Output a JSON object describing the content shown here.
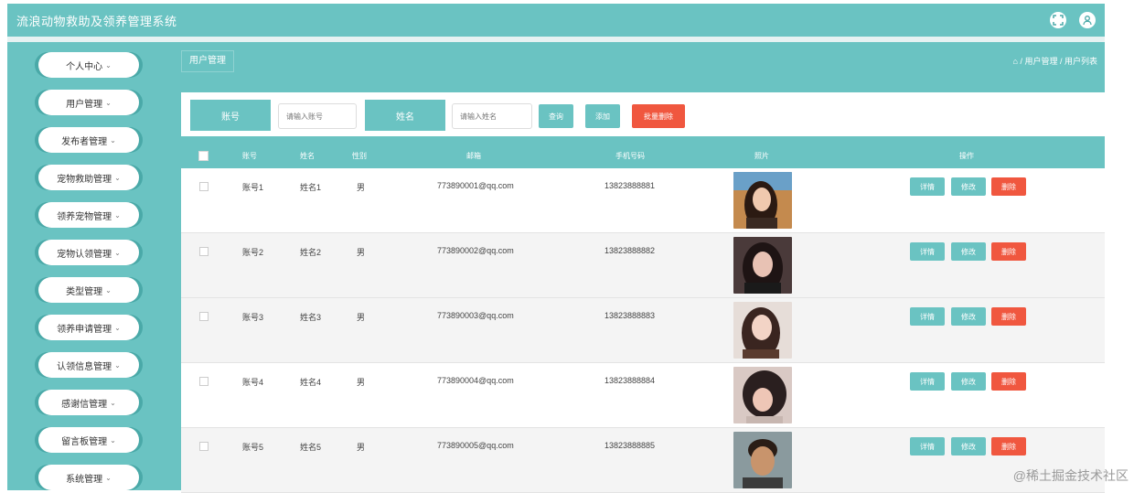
{
  "app": {
    "title": "流浪动物救助及领养管理系统"
  },
  "sidebar": {
    "items": [
      {
        "label": "个人中心"
      },
      {
        "label": "用户管理"
      },
      {
        "label": "发布者管理"
      },
      {
        "label": "宠物救助管理"
      },
      {
        "label": "领养宠物管理"
      },
      {
        "label": "宠物认领管理"
      },
      {
        "label": "类型管理"
      },
      {
        "label": "领养申请管理"
      },
      {
        "label": "认领信息管理"
      },
      {
        "label": "感谢信管理"
      },
      {
        "label": "留言板管理"
      },
      {
        "label": "系统管理"
      }
    ]
  },
  "header": {
    "page_tab": "用户管理",
    "breadcrumb": "⌂ / 用户管理 / 用户列表"
  },
  "search": {
    "account_label": "账号",
    "account_placeholder": "请输入账号",
    "name_label": "姓名",
    "name_placeholder": "请输入姓名",
    "query_btn": "查询",
    "add_btn": "添加",
    "batch_delete_btn": "批量删除"
  },
  "table": {
    "columns": [
      "账号",
      "姓名",
      "性别",
      "邮箱",
      "手机号码",
      "照片",
      "操作"
    ],
    "action_labels": {
      "view": "详情",
      "edit": "修改",
      "delete": "删除"
    },
    "rows": [
      {
        "account": "账号1",
        "name": "姓名1",
        "gender": "男",
        "email": "773890001@qq.com",
        "phone": "13823888881"
      },
      {
        "account": "账号2",
        "name": "姓名2",
        "gender": "男",
        "email": "773890002@qq.com",
        "phone": "13823888882"
      },
      {
        "account": "账号3",
        "name": "姓名3",
        "gender": "男",
        "email": "773890003@qq.com",
        "phone": "13823888883"
      },
      {
        "account": "账号4",
        "name": "姓名4",
        "gender": "男",
        "email": "773890004@qq.com",
        "phone": "13823888884"
      },
      {
        "account": "账号5",
        "name": "姓名5",
        "gender": "男",
        "email": "773890005@qq.com",
        "phone": "13823888885"
      }
    ]
  },
  "watermark": "@稀土掘金技术社区",
  "colors": {
    "primary": "#6ac3c2",
    "danger": "#f0573f",
    "sidebar_edge": "#4aa9a8"
  },
  "icons": {
    "fullscreen": "fullscreen-icon",
    "user": "user-icon"
  }
}
